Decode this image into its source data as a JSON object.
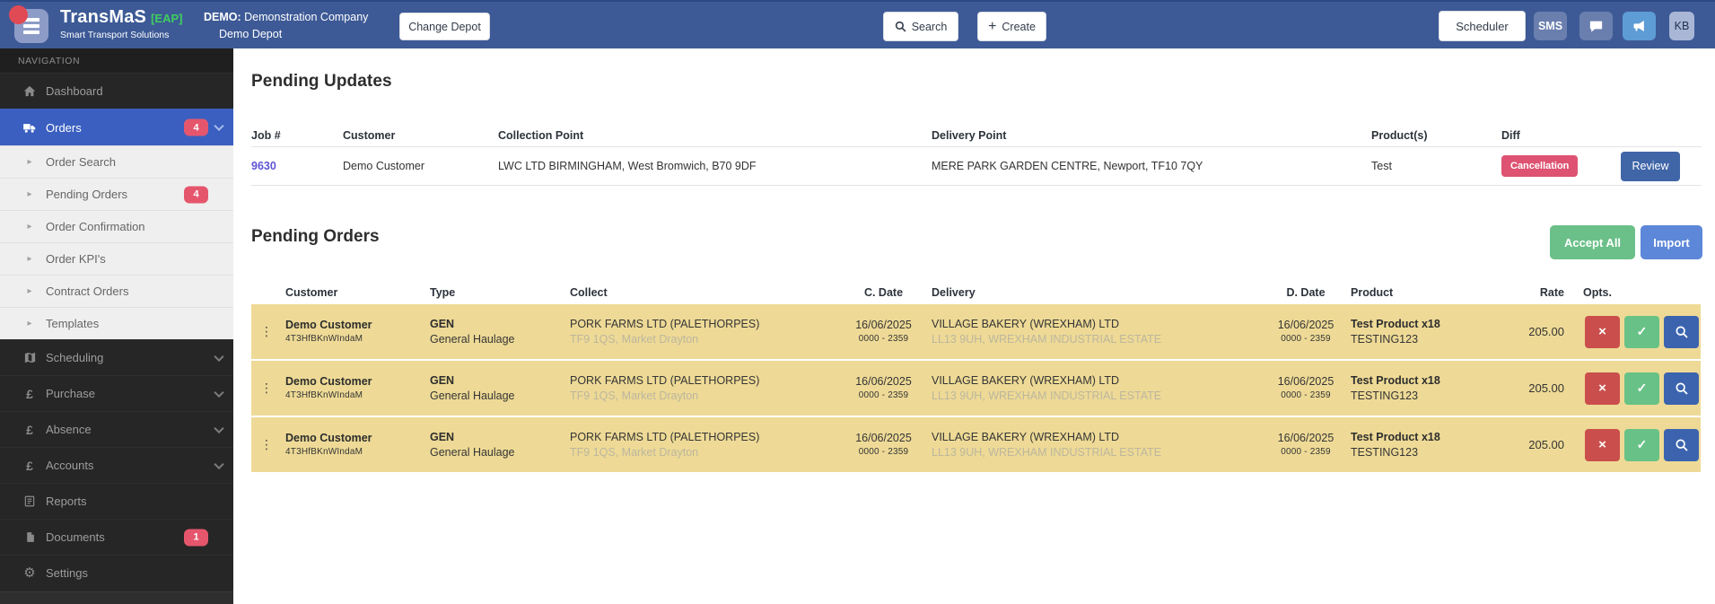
{
  "header": {
    "brand_name": "TransMaS",
    "brand_tag": "[EAP]",
    "brand_tagline": "Smart Transport Solutions",
    "company_label": "DEMO:",
    "company_name": "Demonstration Company",
    "depot_name": "Demo Depot",
    "change_depot_label": "Change Depot",
    "search_label": "Search",
    "create_label": "Create",
    "scheduler_label": "Scheduler",
    "sms_label": "SMS",
    "kb_label": "KB"
  },
  "icons": {
    "plus": "+",
    "gear": "⚙",
    "dots": "⋮",
    "caret": "▸",
    "check": "✓",
    "close": "×",
    "pound": "£"
  },
  "colors": {
    "header_bg": "#3d5a96",
    "sidebar_bg": "#262626",
    "active_item_blue": "#3a5fc0",
    "badge_pink": "#e5566d",
    "brand_green": "#3ecf5e",
    "row_highlight_yellow": "#eeda96",
    "cancel_pill_pink": "#de5372",
    "review_blue": "#4066a8",
    "accept_green": "#6bc089",
    "import_blue": "#5d87d8",
    "reject_red": "#ca4f4c",
    "approve_green": "#68c287",
    "search_opt_blue": "#3c64ae",
    "job_link_purple": "#5f55d6"
  },
  "sidebar": {
    "section_label": "NAVIGATION",
    "items": [
      {
        "label": "Dashboard"
      },
      {
        "label": "Orders",
        "badge": "4"
      },
      {
        "label": "Order Search"
      },
      {
        "label": "Pending Orders",
        "badge": "4"
      },
      {
        "label": "Order Confirmation"
      },
      {
        "label": "Order KPI's"
      },
      {
        "label": "Contract Orders"
      },
      {
        "label": "Templates"
      },
      {
        "label": "Scheduling"
      },
      {
        "label": "Purchase"
      },
      {
        "label": "Absence"
      },
      {
        "label": "Accounts"
      },
      {
        "label": "Reports"
      },
      {
        "label": "Documents",
        "badge": "1"
      },
      {
        "label": "Settings"
      }
    ]
  },
  "pending_updates": {
    "title": "Pending Updates",
    "columns": {
      "job": "Job #",
      "customer": "Customer",
      "collection": "Collection Point",
      "delivery": "Delivery Point",
      "products": "Product(s)",
      "diff": "Diff"
    },
    "rows": [
      {
        "job": "9630",
        "customer": "Demo Customer",
        "collection": "LWC LTD BIRMINGHAM, West Bromwich, B70 9DF",
        "delivery": "MERE PARK GARDEN CENTRE, Newport, TF10 7QY",
        "products": "Test",
        "diff": "Cancellation",
        "action": "Review"
      }
    ]
  },
  "pending_orders": {
    "title": "Pending Orders",
    "accept_all_label": "Accept All",
    "import_label": "Import",
    "columns": {
      "customer": "Customer",
      "type": "Type",
      "collect": "Collect",
      "cdate": "C. Date",
      "delivery": "Delivery",
      "ddate": "D. Date",
      "product": "Product",
      "rate": "Rate",
      "opts": "Opts."
    },
    "rows": [
      {
        "customer": "Demo Customer",
        "customer_ref": "4T3HfBKnWIndaM",
        "type_code": "GEN",
        "type_name": "General Haulage",
        "collect_name": "PORK FARMS LTD (PALETHORPES)",
        "collect_addr": "TF9 1QS, Market Drayton",
        "cdate": "16/06/2025",
        "ctime": "0000 - 2359",
        "delivery_name": "VILLAGE BAKERY (WREXHAM) LTD",
        "delivery_addr": "LL13 9UH, WREXHAM INDUSTRIAL ESTATE",
        "ddate": "16/06/2025",
        "dtime": "0000 - 2359",
        "product_name": "Test Product x18",
        "product_ref": "TESTING123",
        "rate": "205.00"
      },
      {
        "customer": "Demo Customer",
        "customer_ref": "4T3HfBKnWIndaM",
        "type_code": "GEN",
        "type_name": "General Haulage",
        "collect_name": "PORK FARMS LTD (PALETHORPES)",
        "collect_addr": "TF9 1QS, Market Drayton",
        "cdate": "16/06/2025",
        "ctime": "0000 - 2359",
        "delivery_name": "VILLAGE BAKERY (WREXHAM) LTD",
        "delivery_addr": "LL13 9UH, WREXHAM INDUSTRIAL ESTATE",
        "ddate": "16/06/2025",
        "dtime": "0000 - 2359",
        "product_name": "Test Product x18",
        "product_ref": "TESTING123",
        "rate": "205.00"
      },
      {
        "customer": "Demo Customer",
        "customer_ref": "4T3HfBKnWIndaM",
        "type_code": "GEN",
        "type_name": "General Haulage",
        "collect_name": "PORK FARMS LTD (PALETHORPES)",
        "collect_addr": "TF9 1QS, Market Drayton",
        "cdate": "16/06/2025",
        "ctime": "0000 - 2359",
        "delivery_name": "VILLAGE BAKERY (WREXHAM) LTD",
        "delivery_addr": "LL13 9UH, WREXHAM INDUSTRIAL ESTATE",
        "ddate": "16/06/2025",
        "dtime": "0000 - 2359",
        "product_name": "Test Product x18",
        "product_ref": "TESTING123",
        "rate": "205.00"
      }
    ]
  }
}
